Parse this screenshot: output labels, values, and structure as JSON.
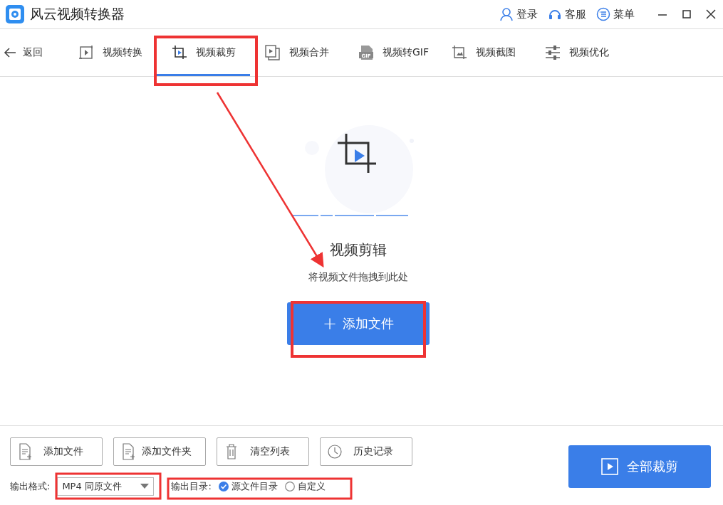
{
  "window": {
    "title": "风云视频转换器",
    "actions": [
      "登录",
      "客服",
      "菜单"
    ]
  },
  "nav": {
    "back": "返回",
    "tabs": [
      {
        "label": "视频转换",
        "selected": false
      },
      {
        "label": "视频裁剪",
        "selected": true
      },
      {
        "label": "视频合并",
        "selected": false
      },
      {
        "label": "视频转GIF",
        "badge": "GIF",
        "selected": false
      },
      {
        "label": "视频截图",
        "selected": false
      },
      {
        "label": "视频优化",
        "selected": false
      }
    ]
  },
  "drop_zone": {
    "title": "视频剪辑",
    "hint": "将视频文件拖拽到此处",
    "button": "添加文件",
    "button_icon": "+"
  },
  "toolbar": [
    "添加文件",
    "添加文件夹",
    "清空列表",
    "历史记录"
  ],
  "output_format": {
    "label": "输出格式:",
    "value": "MP4 同原文件"
  },
  "output_dir": {
    "label": "输出目录:",
    "options": [
      {
        "label": "源文件目录",
        "selected": true
      },
      {
        "label": "自定义",
        "selected": false
      }
    ]
  },
  "start_button": "全部裁剪"
}
